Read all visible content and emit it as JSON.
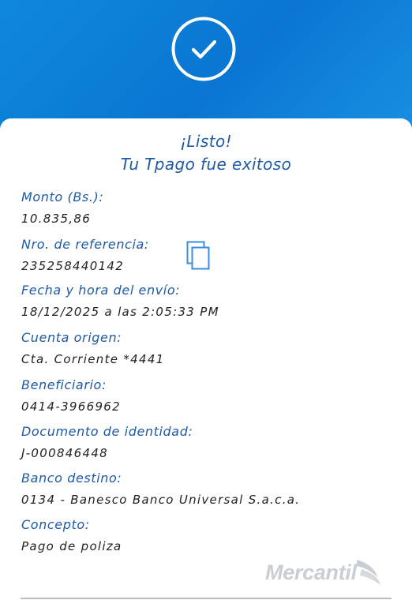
{
  "status": {
    "title_line1": "¡Listo!",
    "title_line2": "Tu Tpago fue exitoso",
    "icon": "checkmark-circle-icon"
  },
  "details": [
    {
      "label": "Monto (Bs.):",
      "value": "10.835,86"
    },
    {
      "label": "Nro. de referencia:",
      "value": "235258440142"
    },
    {
      "label": "Fecha y hora del envío:",
      "value": "18/12/2025 a las 2:05:33 PM"
    },
    {
      "label": "Cuenta origen:",
      "value": "Cta. Corriente *4441"
    },
    {
      "label": "Beneficiario:",
      "value": "0414-3966962"
    },
    {
      "label": "Documento de identidad:",
      "value": "J-000846448"
    },
    {
      "label": "Banco destino:",
      "value": "0134 - Banesco Banco Universal S.a.c.a."
    },
    {
      "label": "Concepto:",
      "value": "Pago de poliza"
    }
  ],
  "copy_icon": "copy-icon",
  "brand": {
    "name": "Mercantil",
    "logo_icon": "mercantil-logo-icon"
  },
  "colors": {
    "header_blue": "#0a7ad6",
    "label_blue": "#1e5aa6",
    "value_text": "#222222",
    "logo_gray": "#c9cdd4"
  }
}
